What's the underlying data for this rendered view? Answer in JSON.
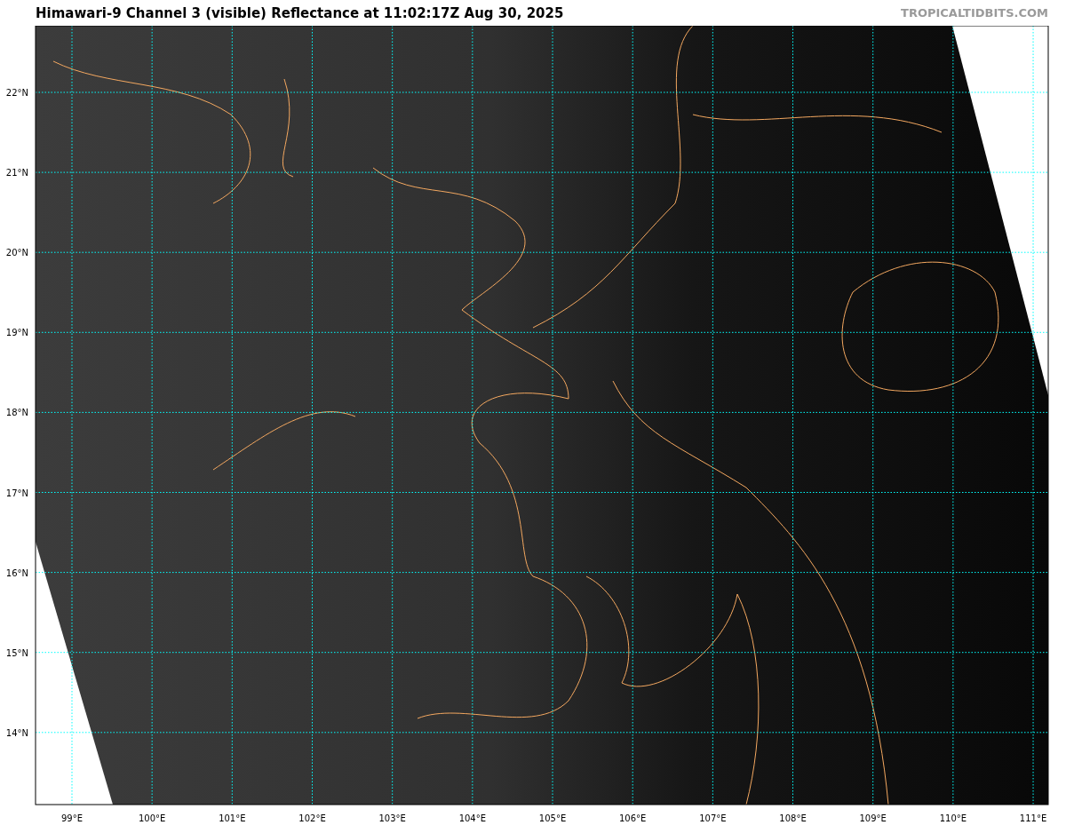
{
  "title": "Himawari-9 Channel 3 (visible) Reflectance at 11:02:17Z Aug 30, 2025",
  "credit": "TROPICALTIDBITS.COM",
  "map": {
    "longitude_labels": [
      "99°E",
      "100°E",
      "101°E",
      "102°E",
      "103°E",
      "104°E",
      "105°E",
      "106°E",
      "107°E",
      "108°E",
      "109°E",
      "110°E",
      "111°E"
    ],
    "latitude_labels": [
      "22°N",
      "21°N",
      "20°N",
      "19°N",
      "18°N",
      "17°N",
      "16°N",
      "15°N",
      "14°N"
    ]
  }
}
